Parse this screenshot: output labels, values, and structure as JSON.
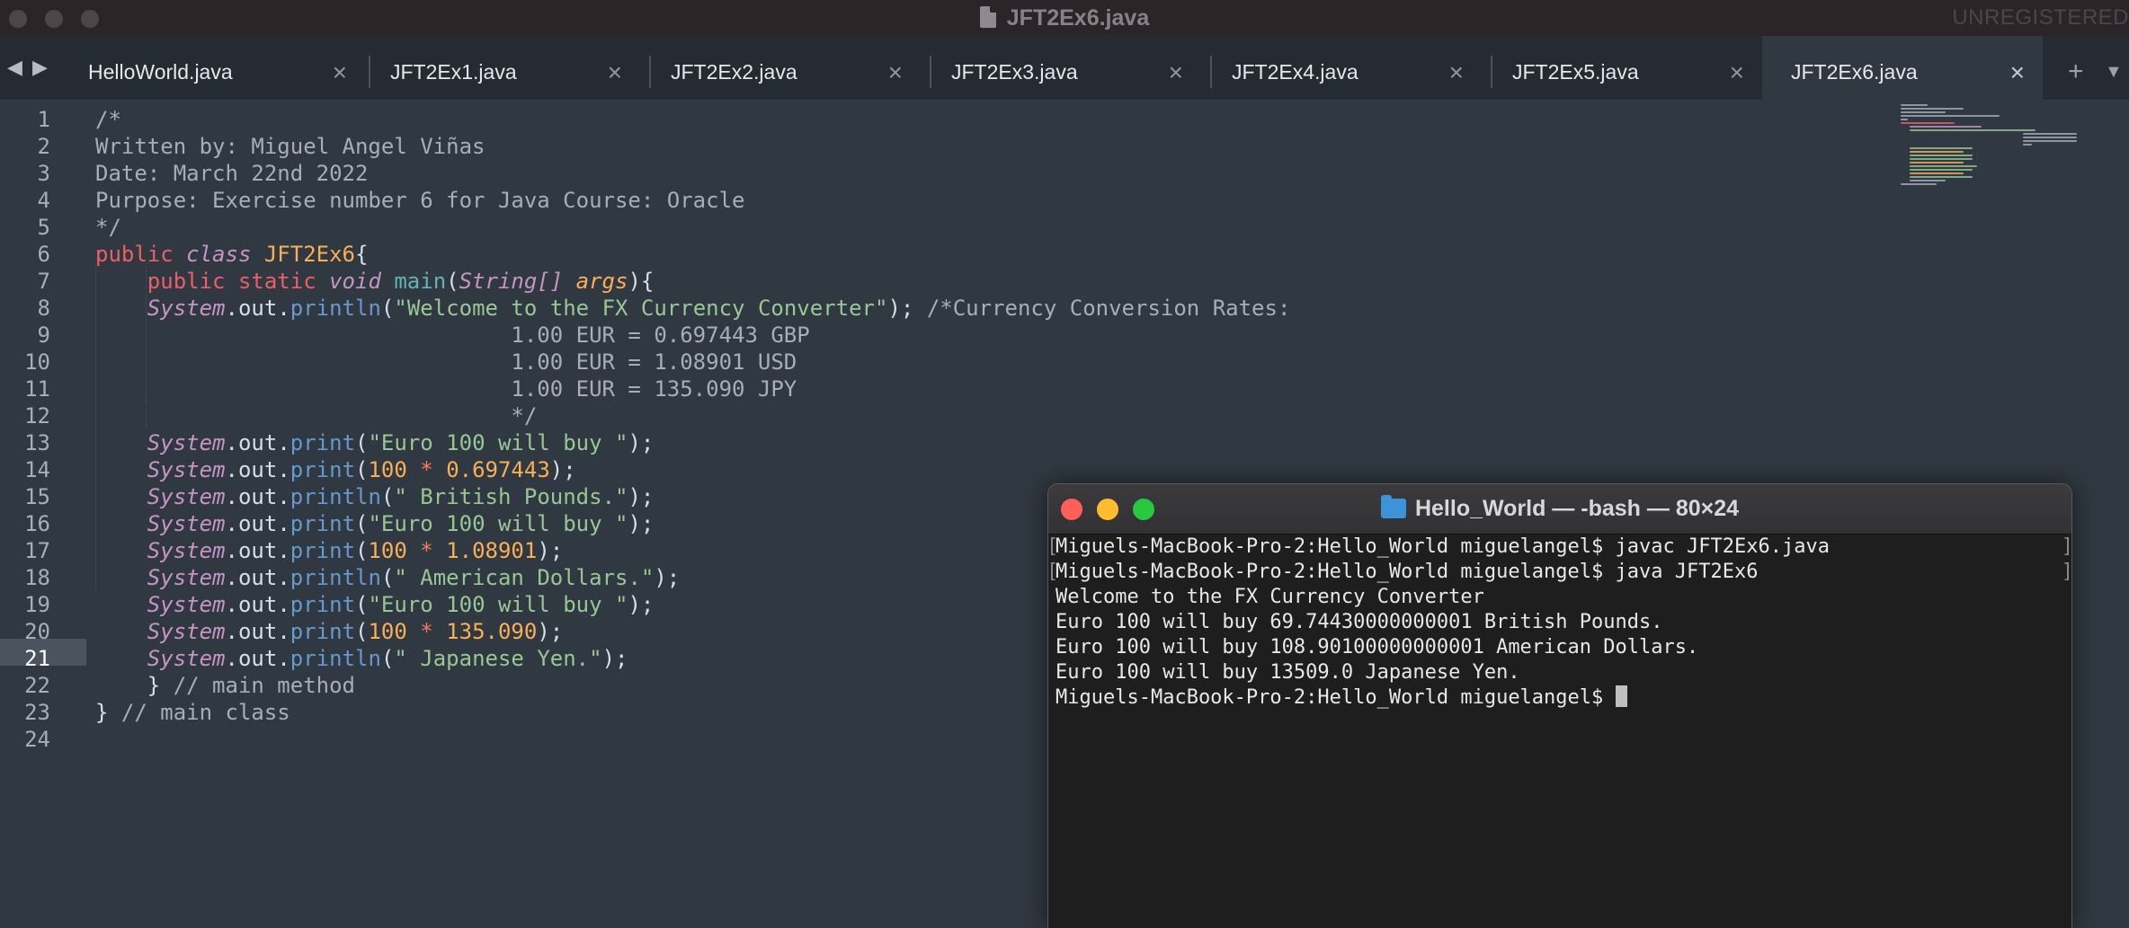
{
  "window": {
    "title": "JFT2Ex6.java",
    "unregistered": "UNREGISTERED"
  },
  "tabs": [
    {
      "label": "HelloWorld.java",
      "active": false
    },
    {
      "label": "JFT2Ex1.java",
      "active": false
    },
    {
      "label": "JFT2Ex2.java",
      "active": false
    },
    {
      "label": "JFT2Ex3.java",
      "active": false
    },
    {
      "label": "JFT2Ex4.java",
      "active": false
    },
    {
      "label": "JFT2Ex5.java",
      "active": false
    },
    {
      "label": "JFT2Ex6.java",
      "active": true
    }
  ],
  "tab_controls": {
    "back": "◀",
    "forward": "▶",
    "close": "×",
    "add": "+",
    "more": "▼"
  },
  "editor": {
    "current_line": "21",
    "line_numbers": [
      "1",
      "2",
      "3",
      "4",
      "5",
      "6",
      "7",
      "8",
      "9",
      "10",
      "11",
      "12",
      "13",
      "14",
      "15",
      "16",
      "17",
      "18",
      "19",
      "20",
      "21",
      "22",
      "23",
      "24"
    ],
    "code": {
      "l1": "/*",
      "l2": "Written by: Miguel Angel Viñas",
      "l3": "Date: March 22nd 2022",
      "l4": "Purpose: Exercise number 6 for Java Course: Oracle",
      "l5": "*/",
      "l6_public": "public",
      "l6_class": "class",
      "l6_name": "JFT2Ex6",
      "l6_brace": "{",
      "l7_public": "public",
      "l7_static": "static",
      "l7_void": "void",
      "l7_main": "main",
      "l7_type": "String[]",
      "l7_args": "args",
      "system": "System",
      "out": "out",
      "println": "println",
      "print": "print",
      "l8_str": "\"Welcome to the FX Currency Converter\"",
      "l8_cmt": "/*Currency Conversion Rates:",
      "l9_cmt": "1.00 EUR = 0.697443 GBP",
      "l10_cmt": "1.00 EUR = 1.08901 USD",
      "l11_cmt": "1.00 EUR = 135.090 JPY",
      "l12_cmt": "*/",
      "str_euro": "\"Euro 100 will buy \"",
      "n100": "100",
      "times": "*",
      "r_gbp": "0.697443",
      "r_usd": "1.08901",
      "r_jpy": "135.090",
      "str_gbp": "\" British Pounds.\"",
      "str_usd": "\" American Dollars.\"",
      "str_jpy": "\" Japanese Yen.\"",
      "l22_brace": "}",
      "l22_cmt": "// main method",
      "l23_brace": "}",
      "l23_cmt": "// main class"
    }
  },
  "terminal": {
    "title": "Hello_World — -bash — 80×24",
    "lines": [
      "Miguels-MacBook-Pro-2:Hello_World miguelangel$ javac JFT2Ex6.java",
      "Miguels-MacBook-Pro-2:Hello_World miguelangel$ java JFT2Ex6",
      "Welcome to the FX Currency Converter",
      "Euro 100 will buy 69.74430000000001 British Pounds.",
      "Euro 100 will buy 108.90100000000001 American Dollars.",
      "Euro 100 will buy 13509.0 Japanese Yen.",
      "Miguels-MacBook-Pro-2:Hello_World miguelangel$ "
    ]
  },
  "colors": {
    "editor_bg": "#303841",
    "tabbar_bg": "#252b33",
    "keyword": "#ec5f66",
    "string": "#99c794",
    "number": "#f9ae58",
    "function": "#6699cc",
    "storage": "#c594c5",
    "terminal_bg": "#1e1e1e",
    "close_red": "#ff5f57",
    "minimize_yellow": "#febc2e",
    "zoom_green": "#28c840"
  }
}
